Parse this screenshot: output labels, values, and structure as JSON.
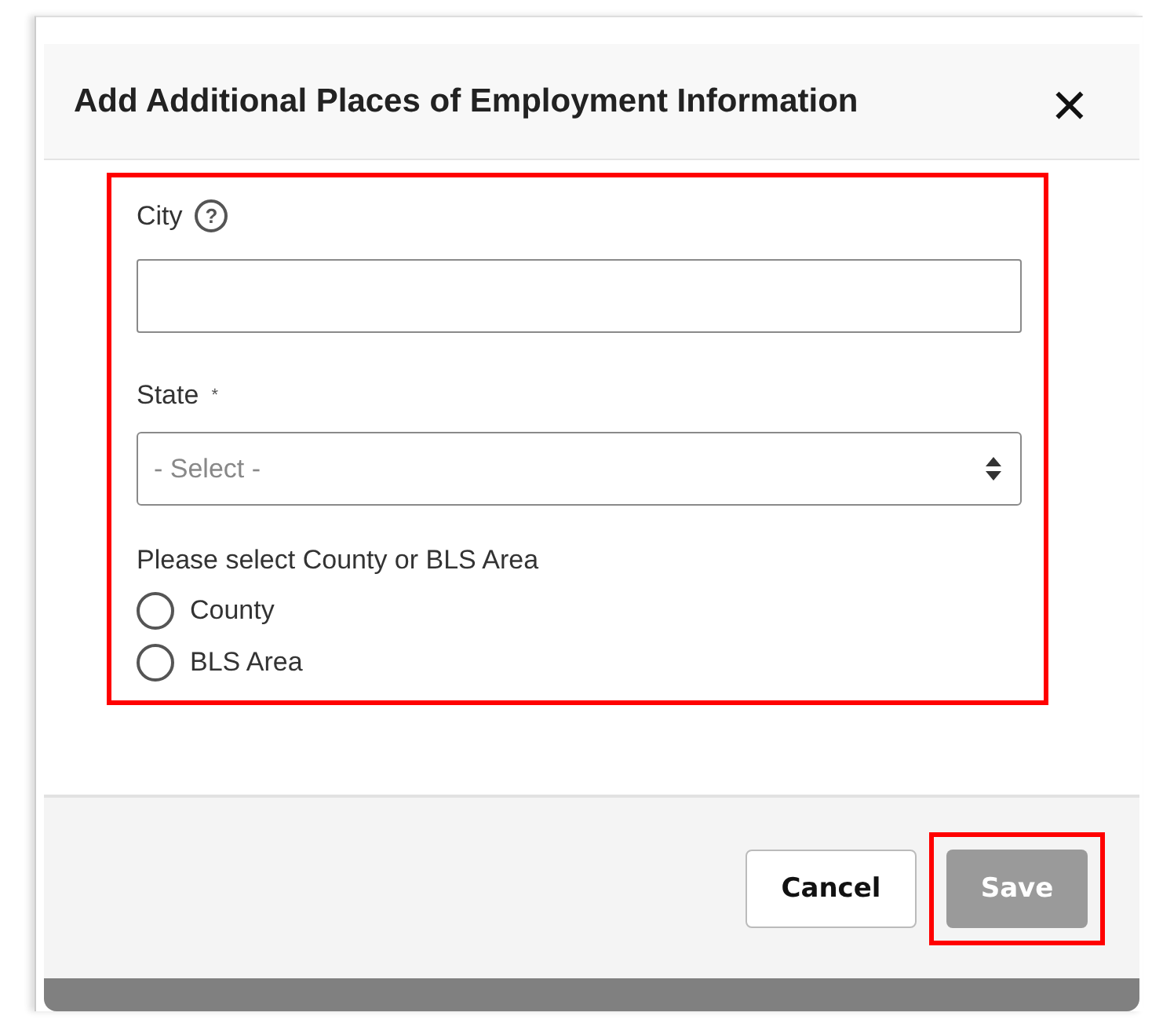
{
  "dialog": {
    "title": "Add Additional Places of Employment Information",
    "close_icon": "✕"
  },
  "form": {
    "highlighted": true,
    "city": {
      "label": "City",
      "help_icon": "?"
    },
    "state": {
      "label": "State",
      "required_mark": "*",
      "placeholder": "- Select -"
    },
    "area_prompt": "Please select County or BLS Area",
    "radios": [
      {
        "label": "County",
        "selected": false
      },
      {
        "label": "BLS Area",
        "selected": false
      }
    ]
  },
  "buttons": [
    {
      "label": "Cancel",
      "kind": "secondary",
      "disabled": false,
      "highlighted": false
    },
    {
      "label": "Save",
      "kind": "primary",
      "disabled": true,
      "highlighted": true
    }
  ]
}
